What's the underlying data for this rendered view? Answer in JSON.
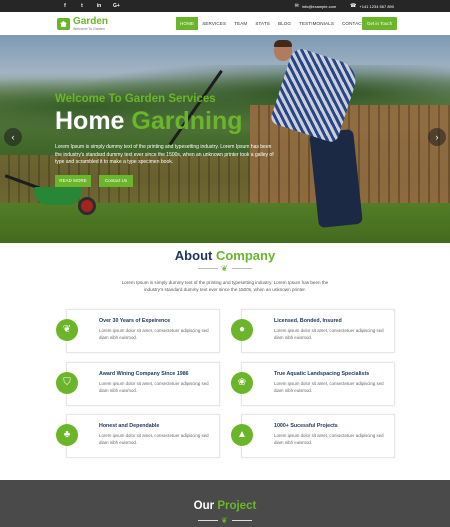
{
  "topbar": {
    "social": [
      "f",
      "t",
      "in",
      "G+"
    ],
    "email_icon": "envelope-icon",
    "email": "info@example.com",
    "phone_icon": "phone-icon",
    "phone": "+141 1234 567 890"
  },
  "nav": {
    "logo_name": "Garden",
    "logo_tagline": "Welcome To Garden",
    "menu": [
      "HOME",
      "SERVICES",
      "TEAM",
      "STATS",
      "BLOG",
      "TESTIMONIALS",
      "CONTACT US"
    ],
    "active_index": 0,
    "cta": "Get in Touch"
  },
  "hero": {
    "subtitle": "Welcome To Garden Services",
    "title_white": "Home ",
    "title_green": "Gardning",
    "description": "Lorem Ipsum is simply dummy text of the printing and typesetting industry. Lorem Ipsum has been the industry's standard dummy text ever since the 1500s, when an unknown printer took a galley of type and scrambled it to make a type specimen book.",
    "button_primary": "READ MORE",
    "button_secondary": "Contact Us",
    "prev_arrow": "‹",
    "next_arrow": "›"
  },
  "about": {
    "title_dark": "About ",
    "title_green": "Company",
    "description": "Lorem Ipsum is simply dummy text of the printing and typesetting industry. Lorem Ipsum has been the industry's standard dummy text ever since the 1500s, when an unknown printer.",
    "features": [
      {
        "icon": "leaf-icon",
        "glyph": "❦",
        "title": "Over 30 Years of Expeirence",
        "text": "Lorem ipsum dolor sit amet, consectetuer adipiscing sed diam nibh euismod."
      },
      {
        "icon": "badge-icon",
        "glyph": "●",
        "title": "Licensed, Bonded, Insured",
        "text": "Lorem ipsum dolor sit amet, consectetuer adipiscing sed diam nibh euismod."
      },
      {
        "icon": "shield-icon",
        "glyph": "⛉",
        "title": "Award Wining Company Since 1986",
        "text": "Lorem ipsum dolor sit amet, consectetuer adipiscing sed diam nibh euismod."
      },
      {
        "icon": "plant-icon",
        "glyph": "❀",
        "title": "True Aquatic Landspacing Specialists",
        "text": "Lorem ipsum dolor sit amet, consectetuer adipiscing sed diam nibh euismod."
      },
      {
        "icon": "tree-icon",
        "glyph": "♣",
        "title": "Honest and Dependable",
        "text": "Lorem ipsum dolor sit amet, consectetuer adipiscing sed diam nibh euismod."
      },
      {
        "icon": "pine-icon",
        "glyph": "▲",
        "title": "1000+ Sucessful Projects",
        "text": "Lorem ipsum dolor sit amet, consectetuer adipiscing sed diam nibh euismod."
      }
    ]
  },
  "project": {
    "title_white": "Our ",
    "title_green": "Project"
  },
  "colors": {
    "accent": "#6bb52a",
    "heading": "#1d3557",
    "topbar": "#262626",
    "project_bg": "#4a4a4a"
  }
}
